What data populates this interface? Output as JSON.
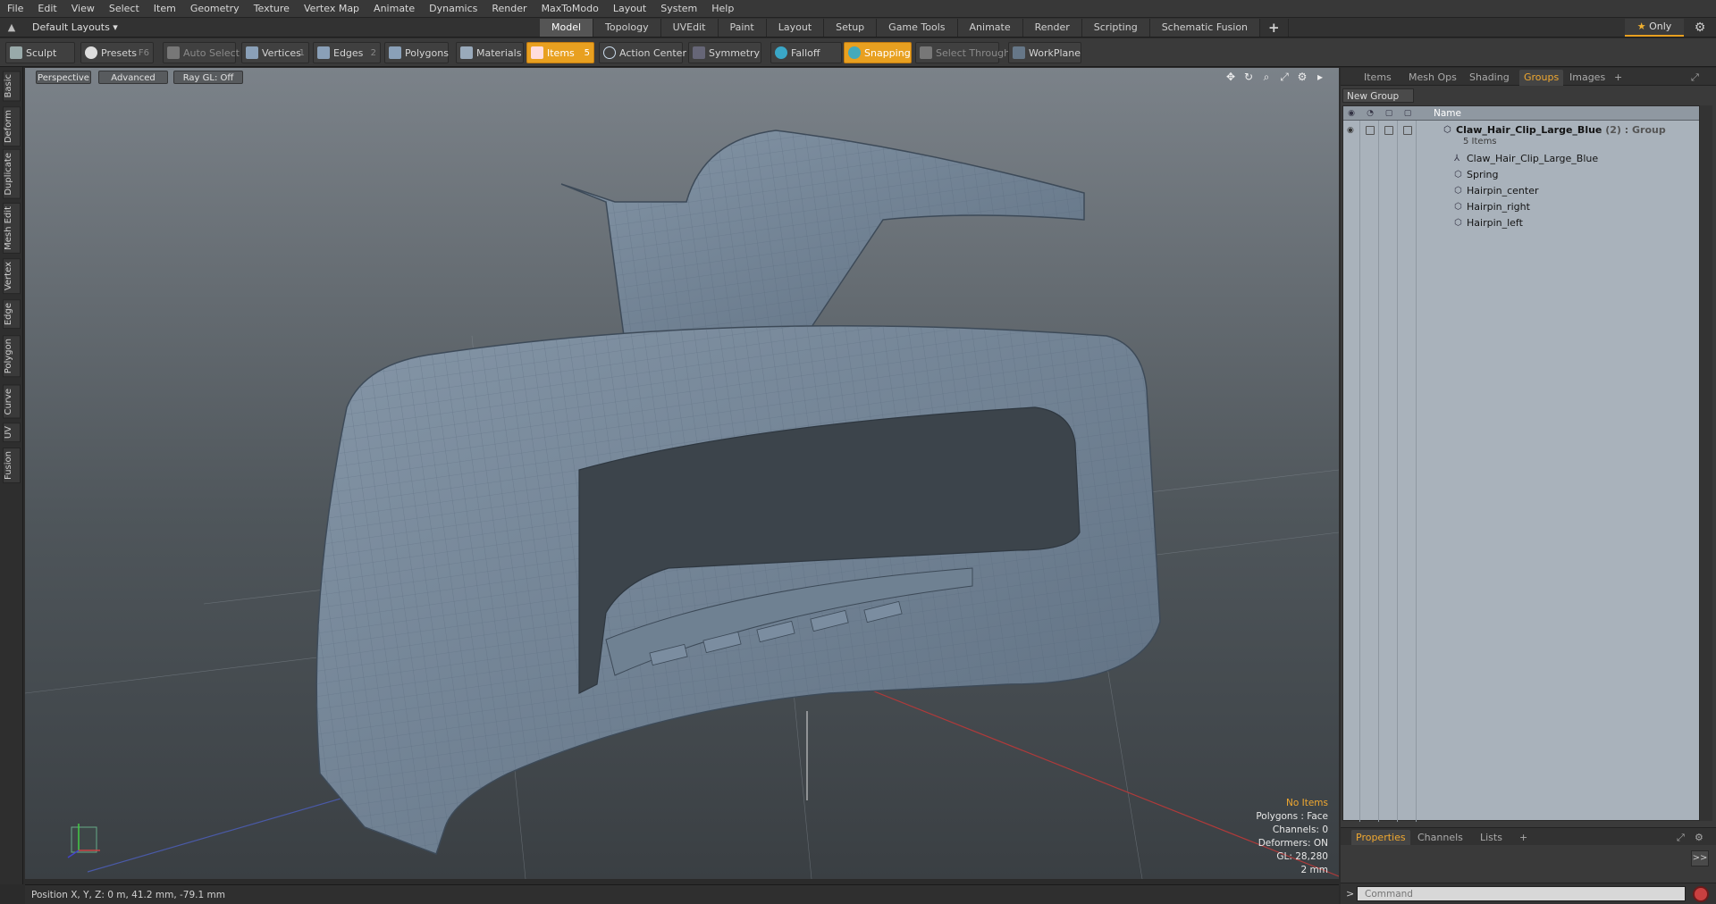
{
  "menu": [
    "File",
    "Edit",
    "View",
    "Select",
    "Item",
    "Geometry",
    "Texture",
    "Vertex Map",
    "Animate",
    "Dynamics",
    "Render",
    "MaxToModo",
    "Layout",
    "System",
    "Help"
  ],
  "layout_selector": "Default Layouts ▾",
  "layout_tabs": [
    "Model",
    "Topology",
    "UVEdit",
    "Paint",
    "Layout",
    "Setup",
    "Game Tools",
    "Animate",
    "Render",
    "Scripting",
    "Schematic Fusion"
  ],
  "active_layout_tab": "Model",
  "only_button": "Only",
  "toolbar": {
    "sculpt": "Sculpt",
    "presets": "Presets",
    "presets_key": "F6",
    "auto_select": "Auto Select",
    "vertices": "Vertices",
    "vertices_key": "1",
    "edges": "Edges",
    "edges_key": "2",
    "polygons": "Polygons",
    "materials": "Materials",
    "items": "Items",
    "items_key": "5",
    "action_center": "Action Center",
    "symmetry": "Symmetry",
    "falloff": "Falloff",
    "snapping": "Snapping",
    "select_through": "Select Through",
    "workplane": "WorkPlane"
  },
  "left_tabs": [
    "Basic",
    "Deform",
    "Duplicate",
    "Mesh Edit",
    "Vertex",
    "Edge",
    "Polygon",
    "Curve",
    "UV",
    "Fusion"
  ],
  "viewport": {
    "view": "Perspective",
    "mode": "Advanced",
    "raygl": "Ray GL: Off",
    "hud": {
      "no_items": "No Items",
      "polygons": "Polygons : Face",
      "channels": "Channels: 0",
      "deformers": "Deformers: ON",
      "gl": "GL: 28,280",
      "scale": "2 mm"
    }
  },
  "status": "Position X, Y, Z:   0 m, 41.2 mm, -79.1 mm",
  "right_panel": {
    "tabs": [
      "Items",
      "Mesh Ops",
      "Shading",
      "Groups",
      "Images",
      "+"
    ],
    "active_tab": "Groups",
    "new_group": "New Group",
    "column_name": "Name",
    "group": {
      "name": "Claw_Hair_Clip_Large_Blue",
      "extra": "(2) : Group",
      "count": "5 Items"
    },
    "items": [
      "Claw_Hair_Clip_Large_Blue",
      "Spring",
      "Hairpin_center",
      "Hairpin_right",
      "Hairpin_left"
    ],
    "bottom_tabs": [
      "Properties",
      "Channels",
      "Lists",
      "+"
    ],
    "active_bottom_tab": "Properties",
    "expand_label": ">>",
    "command_placeholder": "Command"
  },
  "colors": {
    "accent": "#e8a020",
    "mesh": "#6f8192",
    "tree_bg": "#a9b2bb"
  }
}
